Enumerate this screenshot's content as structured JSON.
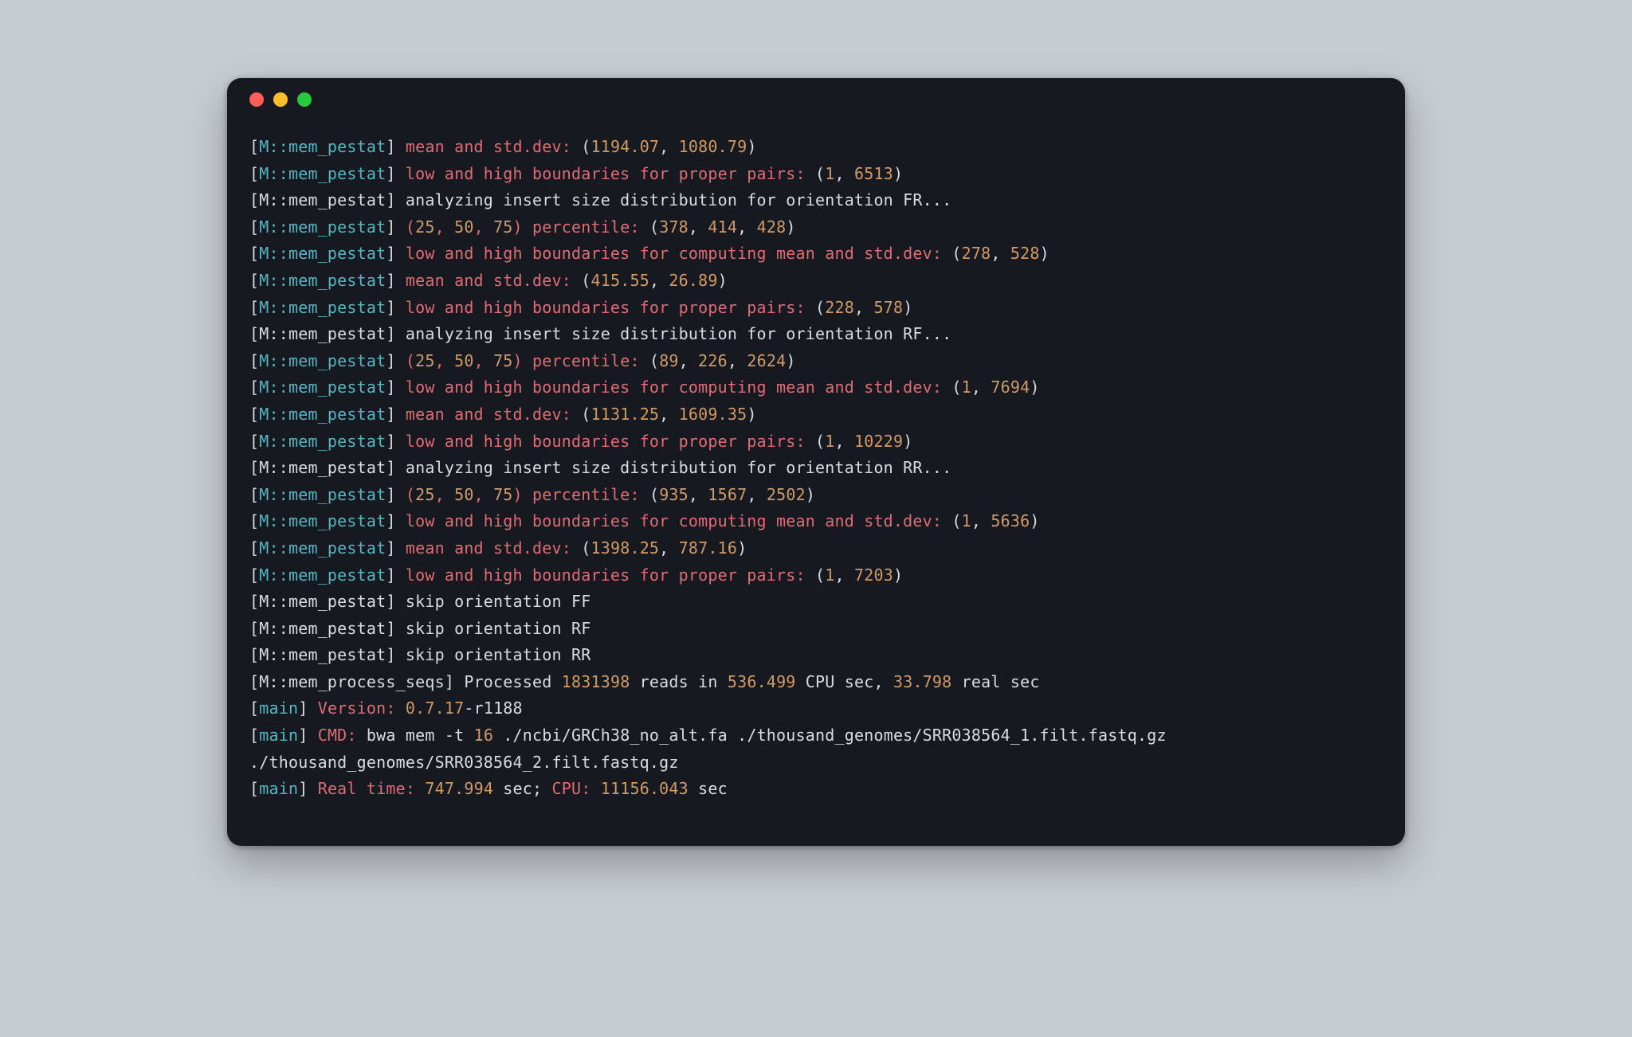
{
  "colors": {
    "bg_page": "#c7ccd3",
    "bg_term": "#161920",
    "red": "#e06c75",
    "cyan": "#56b6c2",
    "orange": "#d19a66",
    "fg": "#d7dde3"
  },
  "window": {
    "dots": [
      "red",
      "yellow",
      "green"
    ]
  },
  "lines": [
    {
      "tag": "M::mem_pestat",
      "tagStyle": "cyan",
      "msg": "mean and std.dev:",
      "msgStyle": "red",
      "vals": [
        "1194.07",
        "1080.79"
      ]
    },
    {
      "tag": "M::mem_pestat",
      "tagStyle": "cyan",
      "msg": "low and high boundaries for proper pairs:",
      "msgStyle": "red",
      "vals": [
        "1",
        "6513"
      ]
    },
    {
      "tag": "M::mem_pestat",
      "tagStyle": "white",
      "msg": "analyzing insert size distribution for orientation FR...",
      "msgStyle": "white"
    },
    {
      "tag": "M::mem_pestat",
      "tagStyle": "cyan",
      "pre_vals": [
        "25",
        "50",
        "75"
      ],
      "msg": "percentile:",
      "msgStyle": "red",
      "vals": [
        "378",
        "414",
        "428"
      ]
    },
    {
      "tag": "M::mem_pestat",
      "tagStyle": "cyan",
      "msg": "low and high boundaries for computing mean and std.dev:",
      "msgStyle": "red",
      "vals": [
        "278",
        "528"
      ]
    },
    {
      "tag": "M::mem_pestat",
      "tagStyle": "cyan",
      "msg": "mean and std.dev:",
      "msgStyle": "red",
      "vals": [
        "415.55",
        "26.89"
      ]
    },
    {
      "tag": "M::mem_pestat",
      "tagStyle": "cyan",
      "msg": "low and high boundaries for proper pairs:",
      "msgStyle": "red",
      "vals": [
        "228",
        "578"
      ]
    },
    {
      "tag": "M::mem_pestat",
      "tagStyle": "white",
      "msg": "analyzing insert size distribution for orientation RF...",
      "msgStyle": "white"
    },
    {
      "tag": "M::mem_pestat",
      "tagStyle": "cyan",
      "pre_vals": [
        "89",
        "226",
        "2624"
      ],
      "_": "",
      "msg_pre": "(25, 50, 75) percentile:",
      "msg": "percentile:",
      "msgStyle": "red",
      "vals_override_pre": true,
      "pre25": "25",
      "pre50": "50",
      "pre75": "75",
      "vals": [
        "89",
        "226",
        "2624"
      ],
      "use_pct": true
    },
    {
      "tag": "M::mem_pestat",
      "tagStyle": "cyan",
      "msg": "low and high boundaries for computing mean and std.dev:",
      "msgStyle": "red",
      "vals": [
        "1",
        "7694"
      ]
    },
    {
      "tag": "M::mem_pestat",
      "tagStyle": "cyan",
      "msg": "mean and std.dev:",
      "msgStyle": "red",
      "vals": [
        "1131.25",
        "1609.35"
      ]
    },
    {
      "tag": "M::mem_pestat",
      "tagStyle": "cyan",
      "msg": "low and high boundaries for proper pairs:",
      "msgStyle": "red",
      "vals": [
        "1",
        "10229"
      ]
    },
    {
      "tag": "M::mem_pestat",
      "tagStyle": "white",
      "msg": "analyzing insert size distribution for orientation RR...",
      "msgStyle": "white"
    },
    {
      "tag": "M::mem_pestat",
      "tagStyle": "cyan",
      "msg": "percentile:",
      "msgStyle": "red",
      "use_pct": true,
      "pre25": "25",
      "pre50": "50",
      "pre75": "75",
      "vals": [
        "935",
        "1567",
        "2502"
      ]
    },
    {
      "tag": "M::mem_pestat",
      "tagStyle": "cyan",
      "msg": "low and high boundaries for computing mean and std.dev:",
      "msgStyle": "red",
      "vals": [
        "1",
        "5636"
      ]
    },
    {
      "tag": "M::mem_pestat",
      "tagStyle": "cyan",
      "msg": "mean and std.dev:",
      "msgStyle": "red",
      "vals": [
        "1398.25",
        "787.16"
      ]
    },
    {
      "tag": "M::mem_pestat",
      "tagStyle": "cyan",
      "msg": "low and high boundaries for proper pairs:",
      "msgStyle": "red",
      "vals": [
        "1",
        "7203"
      ]
    },
    {
      "tag": "M::mem_pestat",
      "tagStyle": "white",
      "msg": "skip orientation FF",
      "msgStyle": "white"
    },
    {
      "tag": "M::mem_pestat",
      "tagStyle": "white",
      "msg": "skip orientation RF",
      "msgStyle": "white"
    },
    {
      "tag": "M::mem_pestat",
      "tagStyle": "white",
      "msg": "skip orientation RR",
      "msgStyle": "white"
    },
    {
      "tag": "M::mem_process_seqs",
      "tagStyle": "white",
      "raw": "Processed 1831398 reads in 536.499 CPU sec, 33.798 real sec",
      "raw_nums": [
        "1831398",
        "536.499",
        "33.798"
      ]
    },
    {
      "tag": "main",
      "tagStyle": "cyan",
      "key": "Version:",
      "keyStyle": "red",
      "after": "0.7.17-r1188",
      "afterNums": [
        "0.7.17"
      ]
    },
    {
      "tag": "main",
      "tagStyle": "cyan",
      "key": "CMD:",
      "keyStyle": "red",
      "after": "bwa mem -t 16 ./ncbi/GRCh38_no_alt.fa ./thousand_genomes/SRR038564_1.filt.fastq.gz ./thousand_genomes/SRR038564_2.filt.fastq.gz",
      "afterNums": [
        "16"
      ]
    },
    {
      "tag": "main",
      "tagStyle": "cyan",
      "key": "Real time:",
      "keyStyle": "red",
      "after_rt": {
        "rt": "747.994",
        "cpu_label": "CPU:",
        "cpu": "11156.043"
      }
    }
  ],
  "pct_line_indices": [
    3,
    8,
    13
  ]
}
